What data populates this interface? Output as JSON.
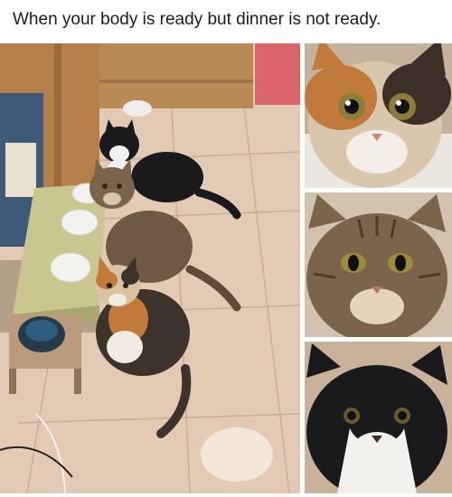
{
  "meme": {
    "caption": "When your body is ready but dinner is not ready."
  },
  "photos": {
    "main": {
      "subject": "three-cats-waiting-by-empty-bowls"
    },
    "closeups": [
      {
        "subject": "calico-cat-closeup"
      },
      {
        "subject": "tabby-cat-closeup"
      },
      {
        "subject": "tuxedo-cat-closeup"
      }
    ]
  },
  "colors": {
    "background": "#ffffff",
    "caption_text": "#1c1c1c",
    "floor_tile": "#e4cdb8",
    "tabby": "#6e5a44",
    "tuxedo_black": "#1a1a1c",
    "calico_orange": "#c27a3c"
  }
}
